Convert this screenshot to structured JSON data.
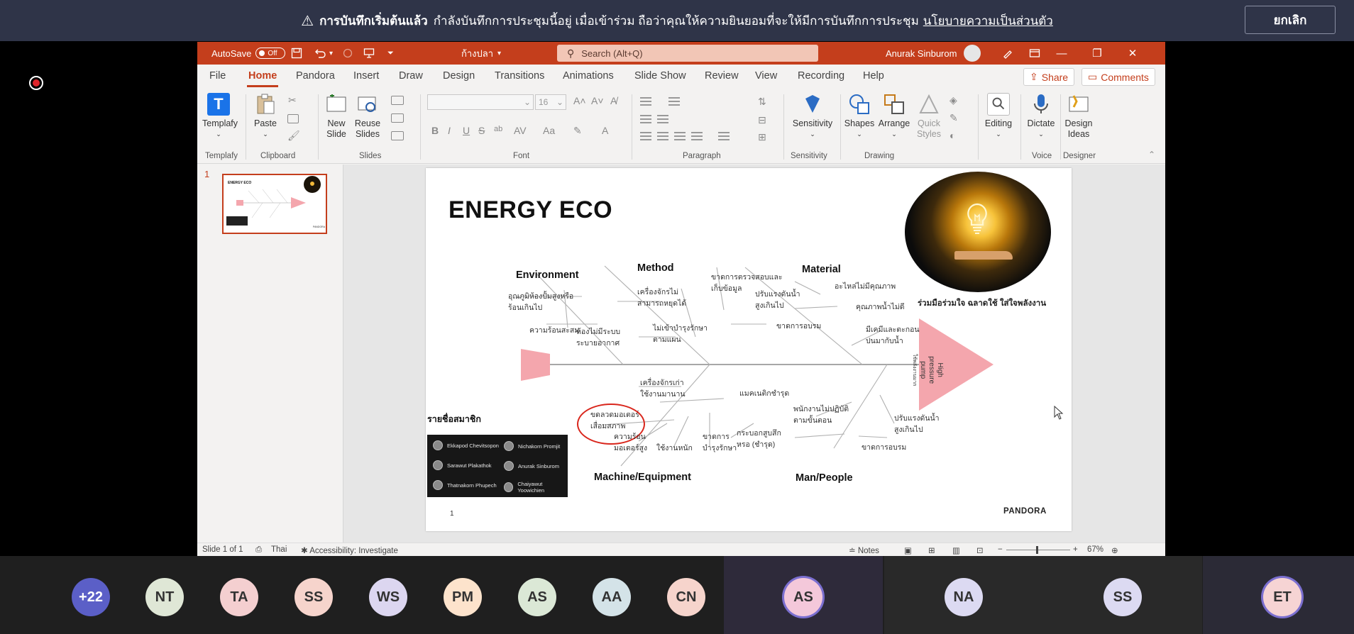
{
  "banner": {
    "bold_text": "การบันทึกเริ่มต้นแล้ว",
    "message": "กำลังบันทึกการประชุมนี้อยู่ เมื่อเข้าร่วม ถือว่าคุณให้ความยินยอมที่จะให้มีการบันทึกการประชุม",
    "privacy_link": "นโยบายความเป็นส่วนตัว",
    "stop_button": "ยกเลิก"
  },
  "titlebar": {
    "autosave": "AutoSave",
    "autosave_state": "Off",
    "filename": "ก้างปลา",
    "search_placeholder": "Search (Alt+Q)",
    "user": "Anurak Sinburom"
  },
  "menu": {
    "tabs": [
      "File",
      "Home",
      "Pandora",
      "Insert",
      "Draw",
      "Design",
      "Transitions",
      "Animations",
      "Slide Show",
      "Review",
      "View",
      "Recording",
      "Help"
    ],
    "active": "Home",
    "share": "Share",
    "comments": "Comments"
  },
  "ribbon": {
    "templafy": "Templafy",
    "paste": "Paste",
    "new_slide": [
      "New",
      "Slide"
    ],
    "reuse_slides": [
      "Reuse",
      "Slides"
    ],
    "font_size": "16",
    "sensitivity": "Sensitivity",
    "shapes": "Shapes",
    "arrange": "Arrange",
    "quick_styles": [
      "Quick",
      "Styles"
    ],
    "editing": "Editing",
    "dictate": "Dictate",
    "design_ideas": [
      "Design",
      "Ideas"
    ],
    "groups": [
      "Templafy",
      "Clipboard",
      "Slides",
      "Font",
      "Paragraph",
      "Sensitivity",
      "Drawing",
      "Voice",
      "Designer"
    ]
  },
  "thumb": {
    "number": "1"
  },
  "slide": {
    "title": "ENERGY ECO",
    "slogan": "ร่วมมือร่วมใจ ฉลาดใช้ ใส่ใจพลังงาน",
    "head_text": [
      "High",
      "pressure",
      "pump",
      "ใช้พลังงานมาก"
    ],
    "categories": {
      "environment": "Environment",
      "method": "Method",
      "material": "Material",
      "machine": "Machine/Equipment",
      "man": "Man/People"
    },
    "causes": {
      "env1": [
        "อุณภูมิห้องปั้มสูงหรือ",
        "ร้อนเกินไป"
      ],
      "env2": "ความร้อนสะสม",
      "env3": [
        "ห้องไม่มีระบบ",
        "ระบายอากาศ"
      ],
      "met1": [
        "เครื่องจักรไม่",
        "สามารถหยุดได้"
      ],
      "met2": [
        "ขาดการตรวจสอบและ",
        "เก็บข้อมูล"
      ],
      "met3": [
        "ปรับแรงดันน้ำ",
        "สูงเกินไป"
      ],
      "met4": [
        "ไม่เข้าบำรุงรักษา",
        "ตามแผน"
      ],
      "met5": "ขาดการอบรม",
      "mat1": "อะไหล่ไม่มีคุณภาพ",
      "mat2": "คุณภาพน้ำไม่ดี",
      "mat3": [
        "มีเคมีและตะกอน",
        "ปนมากับน้ำ"
      ],
      "mach1": [
        "เครื่องจักรเก่า",
        "ใช้งานมานาน"
      ],
      "mach2": "แมคเนติกชำรุด",
      "mach3": [
        "ขดลวดมอเตอร์",
        "เสื่อมสภาพ"
      ],
      "mach4": [
        "ความร้อน",
        "มอเตอร์สูง"
      ],
      "mach5": "ใช้งานหนัก",
      "mach6": [
        "ขาดการ",
        "บำรุงรักษา"
      ],
      "mach7": [
        "กระบอกสูบสึก",
        "หรอ (ชำรุด)"
      ],
      "man1": [
        "พนักงานไม่ปฏิบัติ",
        "ตามขั้นตอน"
      ],
      "man2": [
        "ปรับแรงดันน้ำ",
        "สูงเกินไป"
      ],
      "man3": "ขาดการอบรม"
    },
    "members_title": "รายชื่อสมาชิก",
    "members": [
      "Ekkapod Chevitsopon",
      "Nichakorn Promjit",
      "Sarawut Plakathok",
      "Anurak Sinburom",
      "Thatnakorn Phupech",
      "Chaiyawut Yoowichien"
    ],
    "page_number": "1",
    "brand": "PANDORA"
  },
  "statusbar": {
    "slide_info": "Slide 1 of 1",
    "language": "Thai",
    "accessibility": "Accessibility: Investigate",
    "notes": "Notes",
    "zoom": "67%"
  },
  "participants": [
    {
      "initials": "+22",
      "color": "#5b5fc7",
      "text": "#ffffff"
    },
    {
      "initials": "NT",
      "color": "#dfe7d6",
      "text": "#333333"
    },
    {
      "initials": "TA",
      "color": "#f4cfd0",
      "text": "#333333"
    },
    {
      "initials": "SS",
      "color": "#f6d4cc",
      "text": "#333333"
    },
    {
      "initials": "WS",
      "color": "#dcd6f0",
      "text": "#333333"
    },
    {
      "initials": "PM",
      "color": "#fde3cc",
      "text": "#333333"
    },
    {
      "initials": "AS",
      "color": "#dbe8d6",
      "text": "#333333"
    },
    {
      "initials": "AA",
      "color": "#d4e3e8",
      "text": "#333333"
    },
    {
      "initials": "CN",
      "color": "#f6d4cc",
      "text": "#333333"
    },
    {
      "initials": "AS",
      "color": "#f4c8da",
      "text": "#333333"
    },
    {
      "initials": "NA",
      "color": "#dcdaf2",
      "text": "#333333"
    },
    {
      "initials": "SS",
      "color": "#dcdaf2",
      "text": "#333333"
    },
    {
      "initials": "ET",
      "color": "#f6d4d4",
      "text": "#333333"
    }
  ]
}
